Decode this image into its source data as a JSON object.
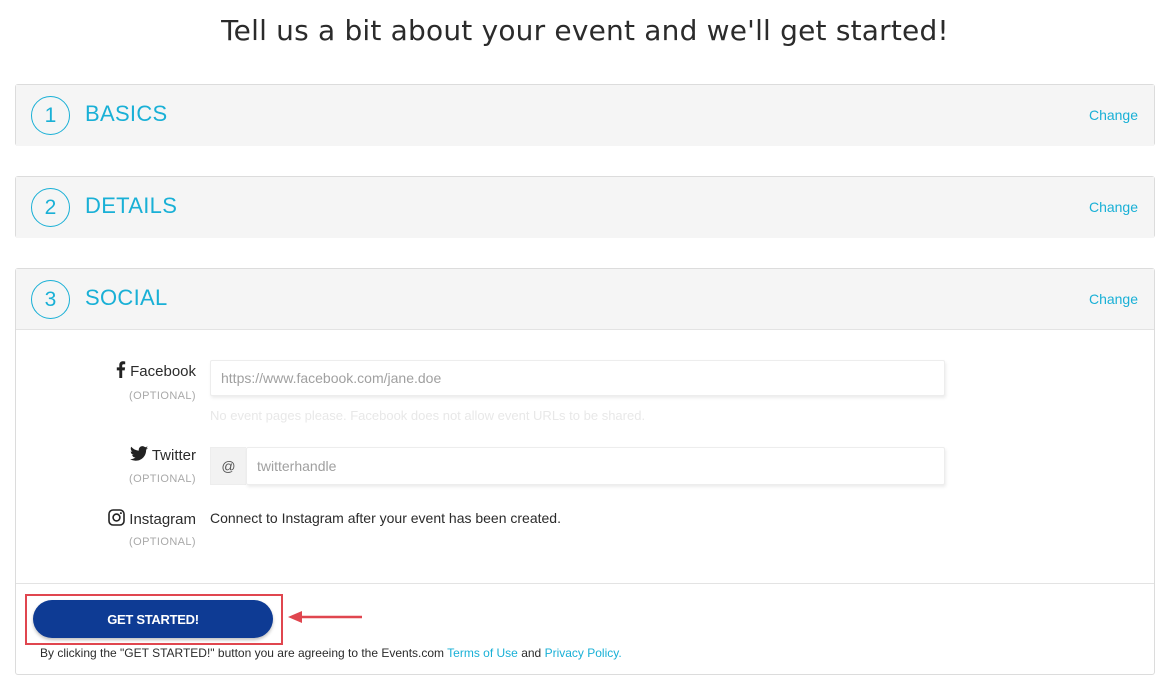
{
  "page": {
    "title": "Tell us a bit about your event and we'll get started!"
  },
  "sections": [
    {
      "number": "1",
      "title": "BASICS",
      "change_label": "Change"
    },
    {
      "number": "2",
      "title": "DETAILS",
      "change_label": "Change"
    },
    {
      "number": "3",
      "title": "SOCIAL",
      "change_label": "Change"
    }
  ],
  "social": {
    "facebook": {
      "label": "Facebook",
      "optional": "(OPTIONAL)",
      "value": "",
      "placeholder": "https://www.facebook.com/jane.doe",
      "help": "No event pages please. Facebook does not allow event URLs to be shared."
    },
    "twitter": {
      "label": "Twitter",
      "optional": "(OPTIONAL)",
      "prefix": "@",
      "value": "",
      "placeholder": "twitterhandle"
    },
    "instagram": {
      "label": "Instagram",
      "optional": "(OPTIONAL)",
      "text": "Connect to Instagram after your event has been created."
    }
  },
  "footer": {
    "button_label": "GET STARTED!",
    "legal_prefix": "By clicking the \"GET STARTED!\" button you are agreeing to the Events.com",
    "terms_label": "Terms of Use",
    "and_text": "and",
    "privacy_label": "Privacy Policy."
  },
  "colors": {
    "accent": "#19b0d6",
    "button": "#0e3b94",
    "highlight": "#e0464f"
  },
  "icons": {
    "facebook": "facebook-icon",
    "twitter": "twitter-icon",
    "instagram": "instagram-icon",
    "arrow": "arrow-left-icon"
  }
}
